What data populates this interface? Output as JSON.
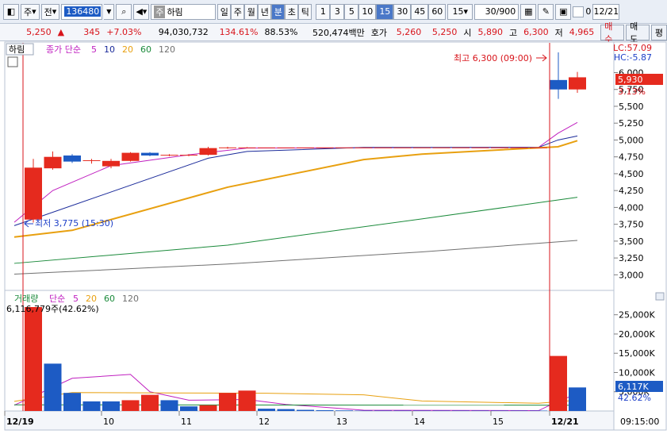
{
  "toolbar": {
    "type_label": "주",
    "period_label": "전",
    "code": "136480",
    "stock_tag": "주",
    "stock_name": "하림",
    "tabs": [
      "일",
      "주",
      "월",
      "년",
      "분",
      "초",
      "틱"
    ],
    "active_tab": "분",
    "intervals": [
      "1",
      "3",
      "5",
      "10",
      "15",
      "30",
      "45",
      "60"
    ],
    "active_interval": "15",
    "interval_select": "15",
    "page_info": "30/900",
    "zero_label": "0",
    "date": "12/21"
  },
  "quote": {
    "price": "5,250",
    "arrow": "▲",
    "change": "345",
    "change_pct": "+7.03%",
    "volume": "94,030,732",
    "volume_ratio": "134.61%",
    "turnover": "88.53%",
    "amount": "520,474백만",
    "bid_label": "호가",
    "ask_price": "5,260",
    "bid_price": "5,250",
    "open_label": "시",
    "open": "5,890",
    "high_label": "고",
    "high": "6,300",
    "low_label": "저",
    "low": "4,965",
    "buy_button": "매수",
    "sell_button": "매도",
    "eval_button": "평"
  },
  "price_panel": {
    "stock_label": "하림",
    "ma_label": "종가 단순",
    "ma_periods": [
      {
        "label": "5",
        "color": "#c020c0"
      },
      {
        "label": "10",
        "color": "#1a2a9a"
      },
      {
        "label": "20",
        "color": "#e8a010"
      },
      {
        "label": "60",
        "color": "#1a8a3a"
      },
      {
        "label": "120",
        "color": "#707070"
      }
    ],
    "lc": "LC:57.09",
    "hc": "HC:-5.87",
    "high_annotation": "최고 6,300 (09:00)",
    "low_annotation": "최저 3,775 (15:30)",
    "current_price_badge": "5,930",
    "current_pct": "3.13%"
  },
  "volume_panel": {
    "label": "거래량",
    "ma_label": "단순",
    "ma_periods": [
      {
        "label": "5",
        "color": "#c020c0"
      },
      {
        "label": "20",
        "color": "#e8a010"
      },
      {
        "label": "60",
        "color": "#1a8a3a"
      },
      {
        "label": "120",
        "color": "#707070"
      }
    ],
    "volume_info": "6,116,779주(42.62%)",
    "current_badge": "6,117K",
    "current_pct": "42.62%"
  },
  "x_axis": {
    "labels": [
      "12/19",
      "10",
      "11",
      "12",
      "13",
      "14",
      "15",
      "12/21"
    ],
    "time_readout": "09:15:00"
  },
  "chart_data": {
    "type": "candlestick",
    "price_axis": {
      "min": 2875,
      "max": 6300,
      "ticks": [
        "6,000",
        "5,750",
        "5,500",
        "5,250",
        "5,000",
        "4,750",
        "4,500",
        "4,250",
        "4,000",
        "3,750",
        "3,500",
        "3,250",
        "3,000"
      ]
    },
    "volume_axis": {
      "max": 27000,
      "ticks": [
        "25,000K",
        "20,000K",
        "15,000K",
        "10,000K",
        "5,000K"
      ]
    },
    "candles": [
      {
        "o": 3820,
        "c": 4590,
        "h": 4720,
        "l": 3775
      },
      {
        "o": 4580,
        "c": 4750,
        "h": 4830,
        "l": 4560
      },
      {
        "o": 4770,
        "c": 4680,
        "h": 4790,
        "l": 4660
      },
      {
        "o": 4690,
        "c": 4700,
        "h": 4720,
        "l": 4650
      },
      {
        "o": 4610,
        "c": 4690,
        "h": 4720,
        "l": 4580
      },
      {
        "o": 4690,
        "c": 4810,
        "h": 4820,
        "l": 4680
      },
      {
        "o": 4810,
        "c": 4770,
        "h": 4820,
        "l": 4760
      },
      {
        "o": 4770,
        "c": 4780,
        "h": 4790,
        "l": 4760
      },
      {
        "o": 4770,
        "c": 4780,
        "h": 4790,
        "l": 4760
      },
      {
        "o": 4780,
        "c": 4880,
        "h": 4900,
        "l": 4770
      },
      {
        "o": 4880,
        "c": 4890,
        "h": 4900,
        "l": 4870
      },
      {
        "o": 4890,
        "c": 4890,
        "h": 4895,
        "l": 4885
      },
      {
        "o": 4890,
        "c": 4890,
        "h": 4890,
        "l": 4890
      },
      {
        "o": 4890,
        "c": 4890,
        "h": 4890,
        "l": 4890
      },
      {
        "o": 4890,
        "c": 4890,
        "h": 4890,
        "l": 4890
      },
      {
        "o": 4890,
        "c": 4890,
        "h": 4890,
        "l": 4890
      },
      {
        "o": 4890,
        "c": 4890,
        "h": 4890,
        "l": 4890
      },
      {
        "o": 4890,
        "c": 4890,
        "h": 4890,
        "l": 4890
      },
      {
        "o": 4890,
        "c": 4890,
        "h": 4890,
        "l": 4890
      },
      {
        "o": 4890,
        "c": 4890,
        "h": 4890,
        "l": 4890
      },
      {
        "o": 4890,
        "c": 4890,
        "h": 4890,
        "l": 4890
      },
      {
        "o": 4890,
        "c": 4890,
        "h": 4890,
        "l": 4890
      },
      {
        "o": 4890,
        "c": 4890,
        "h": 4890,
        "l": 4890
      },
      {
        "o": 4890,
        "c": 4890,
        "h": 4890,
        "l": 4890
      },
      {
        "o": 4890,
        "c": 4890,
        "h": 4890,
        "l": 4890
      },
      {
        "o": 4890,
        "c": 4890,
        "h": 4890,
        "l": 4890
      },
      {
        "o": 4890,
        "c": 4890,
        "h": 4890,
        "l": 4890
      },
      {
        "o": 5890,
        "c": 5750,
        "h": 6300,
        "l": 5610
      },
      {
        "o": 5750,
        "c": 5930,
        "h": 6010,
        "l": 5700
      }
    ],
    "volumes": [
      {
        "v": 27000,
        "up": true
      },
      {
        "v": 12300,
        "up": false
      },
      {
        "v": 4700,
        "up": false
      },
      {
        "v": 2500,
        "up": false
      },
      {
        "v": 2500,
        "up": false
      },
      {
        "v": 2800,
        "up": true
      },
      {
        "v": 4200,
        "up": true
      },
      {
        "v": 2800,
        "up": false
      },
      {
        "v": 1200,
        "up": false
      },
      {
        "v": 1500,
        "up": true
      },
      {
        "v": 4700,
        "up": true
      },
      {
        "v": 5300,
        "up": true
      },
      {
        "v": 600,
        "up": false
      },
      {
        "v": 500,
        "up": false
      },
      {
        "v": 300,
        "up": false
      },
      {
        "v": 200,
        "up": false
      },
      {
        "v": 150,
        "up": false
      },
      {
        "v": 100,
        "up": false
      },
      {
        "v": 100,
        "up": false
      },
      {
        "v": 100,
        "up": false
      },
      {
        "v": 100,
        "up": false
      },
      {
        "v": 100,
        "up": false
      },
      {
        "v": 100,
        "up": false
      },
      {
        "v": 100,
        "up": false
      },
      {
        "v": 100,
        "up": false
      },
      {
        "v": 100,
        "up": false
      },
      {
        "v": 100,
        "up": false
      },
      {
        "v": 14300,
        "up": true
      },
      {
        "v": 6117,
        "up": false
      }
    ],
    "ma_lines": [
      {
        "period": "5",
        "color": "#c020c0",
        "points": [
          [
            0,
            3780
          ],
          [
            1,
            4250
          ],
          [
            4,
            4620
          ],
          [
            8,
            4780
          ],
          [
            11,
            4880
          ],
          [
            24,
            4890
          ],
          [
            26,
            4890
          ],
          [
            27,
            5100
          ],
          [
            28,
            5260
          ]
        ]
      },
      {
        "period": "10",
        "color": "#1a2a9a",
        "points": [
          [
            0,
            3730
          ],
          [
            9,
            4730
          ],
          [
            11,
            4830
          ],
          [
            17,
            4890
          ],
          [
            26,
            4890
          ],
          [
            27,
            5000
          ],
          [
            28,
            5060
          ]
        ]
      },
      {
        "period": "20",
        "color": "#e8a010",
        "points": [
          [
            0,
            3560
          ],
          [
            2,
            3660
          ],
          [
            10,
            4300
          ],
          [
            17,
            4710
          ],
          [
            20,
            4790
          ],
          [
            27,
            4900
          ],
          [
            28,
            4990
          ]
        ]
      },
      {
        "period": "60",
        "color": "#1a8a3a",
        "points": [
          [
            0,
            3170
          ],
          [
            10,
            3440
          ],
          [
            20,
            3830
          ],
          [
            28,
            4150
          ]
        ]
      },
      {
        "period": "120",
        "color": "#707070",
        "points": [
          [
            0,
            3010
          ],
          [
            10,
            3160
          ],
          [
            20,
            3340
          ],
          [
            28,
            3510
          ]
        ]
      }
    ],
    "volume_ma_lines": [
      {
        "period": "5",
        "color": "#c020c0",
        "points": [
          [
            0,
            1500
          ],
          [
            2,
            8500
          ],
          [
            5,
            9500
          ],
          [
            6,
            5000
          ],
          [
            8,
            2800
          ],
          [
            11,
            3000
          ],
          [
            13,
            1700
          ],
          [
            17,
            200
          ],
          [
            26,
            100
          ],
          [
            27,
            2500
          ],
          [
            28,
            4500
          ]
        ]
      },
      {
        "period": "20",
        "color": "#e8a010",
        "points": [
          [
            0,
            2500
          ],
          [
            2,
            4800
          ],
          [
            7,
            4700
          ],
          [
            12,
            4600
          ],
          [
            17,
            4200
          ],
          [
            20,
            2600
          ],
          [
            26,
            2000
          ],
          [
            28,
            2800
          ]
        ]
      },
      {
        "period": "60",
        "color": "#1a8a3a",
        "points": [
          [
            0,
            1600
          ],
          [
            28,
            1500
          ]
        ]
      }
    ]
  }
}
